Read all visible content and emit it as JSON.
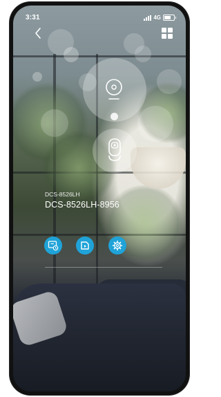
{
  "status_bar": {
    "time": "3:31",
    "network": "4G"
  },
  "header": {
    "back_icon": "chevron-left-icon",
    "menu_icon": "grid-icon"
  },
  "diagram": {
    "hub_icon": "camera-hub-icon",
    "camera_icon": "camera-icon"
  },
  "device": {
    "model": "DCS-8526LH",
    "name": "DCS-8526LH-8956"
  },
  "actions": [
    {
      "icon": "playback-icon"
    },
    {
      "icon": "sd-card-icon"
    },
    {
      "icon": "settings-gear-icon"
    }
  ],
  "colors": {
    "action_button": "#1fa3d8",
    "text": "#ffffff"
  }
}
